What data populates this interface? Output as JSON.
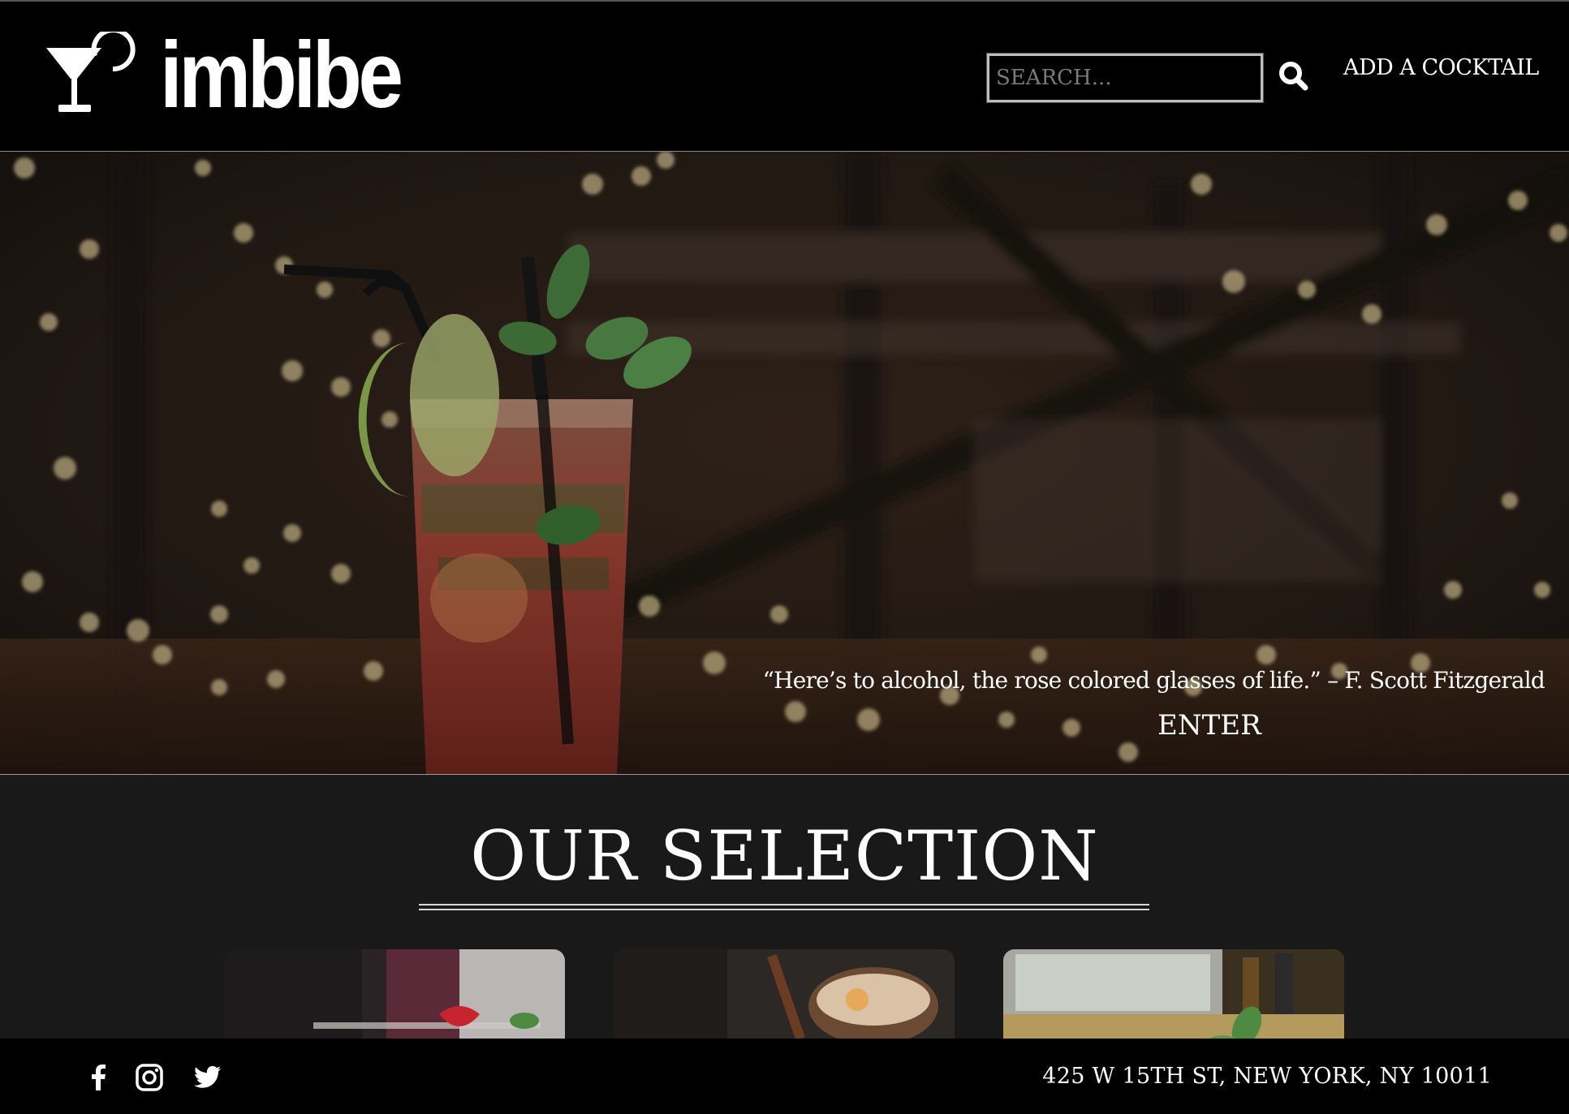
{
  "header": {
    "logo_text": "imbibe",
    "search_placeholder": "SEARCH...",
    "add_cocktail_label": "ADD A COCKTAIL"
  },
  "hero": {
    "quote": "“Here’s to alcohol, the rose colored glasses of life.” – F. Scott Fitzgerald",
    "enter_label": "ENTER"
  },
  "selection": {
    "title": "OUR SELECTION",
    "cards": [
      {
        "image": "strawberry-cocktail"
      },
      {
        "image": "cinnamon-cocktail"
      },
      {
        "image": "mint-cocktail"
      }
    ]
  },
  "footer": {
    "social": [
      "facebook-icon",
      "instagram-icon",
      "twitter-icon"
    ],
    "address": "425 W 15TH ST, NEW YORK, NY 10011"
  },
  "colors": {
    "header_bg": "#000000",
    "page_bg": "#191919",
    "text": "#ffffff"
  }
}
